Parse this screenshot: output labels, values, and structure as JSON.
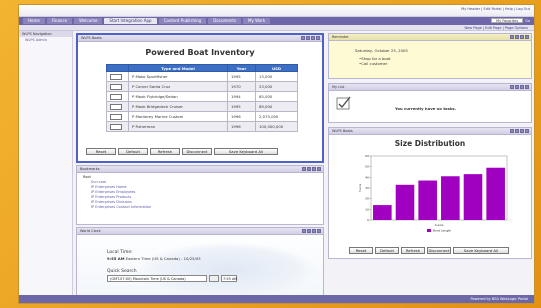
{
  "masthead": {
    "toplinks": "My Header | Edit Portal | Help | Log Out"
  },
  "nav": {
    "tabs": [
      "Home",
      "Finance",
      "Welcome",
      "Start Integration App",
      "Content Publishing",
      "Documents",
      "My Work"
    ],
    "active_index": 3,
    "tools": {
      "select_value": "My Favorites",
      "go": "Go"
    }
  },
  "subbar": {
    "links": "New Page | Edit Page | Page Options"
  },
  "leftnav": {
    "header": "WLPS Navigation",
    "items": [
      "WLPS Admin"
    ]
  },
  "inventory": {
    "panel_title": "WLPS Boats",
    "title": "Powered Boat Inventory",
    "columns": [
      "",
      "Type and Model",
      "Year",
      "USD"
    ],
    "rows": [
      {
        "model": "P Mako Sportfisher",
        "year": "1995",
        "usd": "13,000"
      },
      {
        "model": "P Carver Santa Cruz",
        "year": "1970",
        "usd": "23,000"
      },
      {
        "model": "P Mook Flybridge/Sedan",
        "year": "1994",
        "usd": "85,000"
      },
      {
        "model": "P Mook Bridgedeck Cruiser",
        "year": "1995",
        "usd": "89,000"
      },
      {
        "model": "P Monterey Marine Custom",
        "year": "1996",
        "usd": "2,075,000"
      },
      {
        "model": "P Fisherman",
        "year": "1996",
        "usd": "100,000,000"
      }
    ],
    "buttons": [
      "Reset",
      "Default",
      "Refresh",
      "Disconnect",
      "Save Keyboard All"
    ]
  },
  "bookmarks": {
    "panel_title": "Bookmarks",
    "items": [
      {
        "label": "Root",
        "level": 1,
        "root": true
      },
      {
        "label": "Sun.com",
        "level": 2
      },
      {
        "label": "IP Enterprises Home",
        "level": 2
      },
      {
        "label": "IP Enterprises Employees",
        "level": 2
      },
      {
        "label": "IP Enterprises Products",
        "level": 2
      },
      {
        "label": "IP Enterprises Divisions",
        "level": 2
      },
      {
        "label": "IP Enterprises Contact Information",
        "level": 2
      }
    ]
  },
  "worldclock": {
    "panel_title": "World Clock",
    "local_label": "Local Time:",
    "local_time": "9:55 AM",
    "local_zone": "Eastern Time (US & Canada) - 10/25/05",
    "quick_label": "Quick Search",
    "quick_select": "(GMT-07:00) Mountain Time (US & Canada)",
    "quick_time": "7:55 AM"
  },
  "reminder": {
    "panel_title": "Reminder",
    "date": "Saturday, October 25, 2005",
    "items": [
      "Shop for a boat",
      "Call customer"
    ]
  },
  "todo": {
    "panel_title": "My List",
    "message": "You currently have no tasks."
  },
  "size": {
    "panel_title": "WLPS Boats",
    "buttons": [
      "Reset",
      "Default",
      "Refresh",
      "Disconnect",
      "Save Keyboard All"
    ]
  },
  "chart_data": {
    "type": "bar",
    "title": "Size Distribution",
    "xlabel": "X-axis",
    "ylabel": "Y-axis",
    "categories": [
      "1",
      "2",
      "3",
      "4",
      "5",
      "6"
    ],
    "series": [
      {
        "name": "Boat Length",
        "values": [
          14,
          33,
          37,
          41,
          43,
          49
        ]
      }
    ],
    "ylim": [
      0,
      60
    ],
    "yticks": [
      "0",
      "10",
      "20",
      "30",
      "40",
      "50",
      "60"
    ],
    "bar_color": "#a000c0",
    "legend": "bottom-center",
    "grid": false
  },
  "footer": {
    "text": "Powered by BEA WebLogic Portal"
  },
  "colors": {
    "nav": "#6d66a8",
    "table_header": "#3d70c5",
    "bars": "#a000c0",
    "frame": "#e9a21d"
  }
}
